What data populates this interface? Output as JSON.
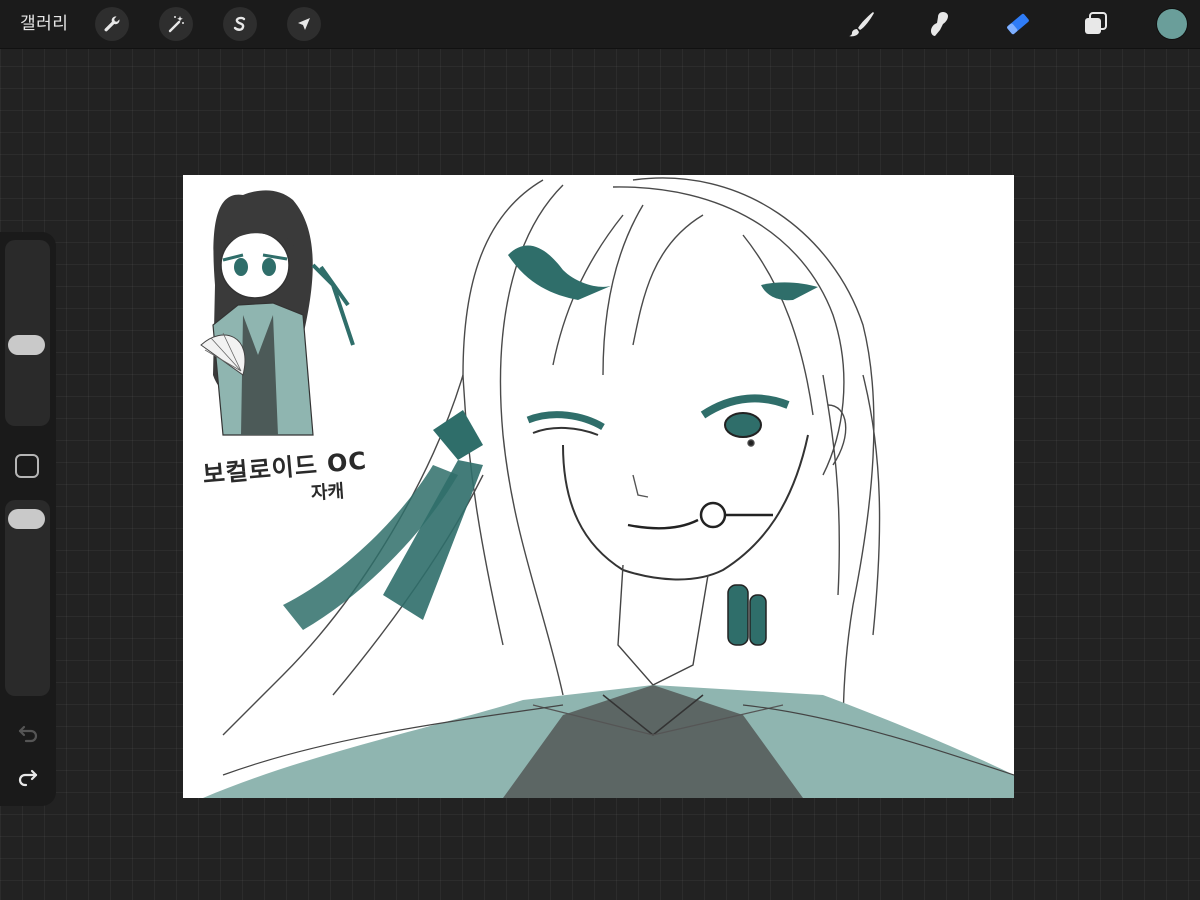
{
  "toolbar": {
    "gallery_label": "갤러리",
    "left_tools": [
      {
        "name": "wrench-icon"
      },
      {
        "name": "magic-wand-icon"
      },
      {
        "name": "selection-icon"
      },
      {
        "name": "transform-arrow-icon"
      }
    ],
    "right_tools": [
      {
        "name": "brush-icon",
        "active": false
      },
      {
        "name": "smudge-icon",
        "active": false
      },
      {
        "name": "eraser-icon",
        "active": true
      },
      {
        "name": "layers-icon",
        "active": false
      }
    ],
    "current_color": "#6a9e9a",
    "active_color": "#2f7cf6"
  },
  "sidebar": {
    "brush_size_level": 0.43,
    "opacity_level": 0.95,
    "modify_icon": "square-icon",
    "undo_icon": "undo-icon",
    "redo_icon": "redo-icon"
  },
  "canvas": {
    "note_line1": "보컬로이드 OC",
    "note_line2": "자캐",
    "colors": {
      "teal": "#2f6e6a",
      "teal_light": "#8fb5b0",
      "ink": "#333333",
      "paper": "#ffffff"
    }
  }
}
